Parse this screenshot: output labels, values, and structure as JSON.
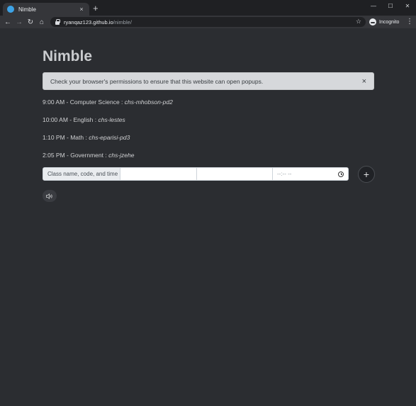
{
  "browser": {
    "tab_title": "Nimble",
    "tab_close": "×",
    "new_tab": "+",
    "window_controls": {
      "minimize": "—",
      "maximize": "☐",
      "close": "✕"
    },
    "nav": {
      "back": "←",
      "forward": "→",
      "reload": "↻",
      "home": "⌂"
    },
    "url_host": "ryanqaz123.github.io",
    "url_path": "/nimble/",
    "star": "☆",
    "incognito_label": "Incognito",
    "menu": "⋮"
  },
  "page": {
    "title": "Nimble",
    "alert": {
      "text": "Check your browser's permissions to ensure that this website can open popups.",
      "close": "×"
    },
    "classes": [
      {
        "time": "9:00 AM",
        "name": "Computer Science",
        "code": "chs-mhobson-pd2"
      },
      {
        "time": "10:00 AM",
        "name": "English",
        "code": "chs-lestes"
      },
      {
        "time": "1:10 PM",
        "name": "Math",
        "code": "chs-eparisi-pd3"
      },
      {
        "time": "2:05 PM",
        "name": "Government",
        "code": "chs-jzehe"
      }
    ],
    "form": {
      "label": "Class name, code, and time",
      "name_value": "",
      "code_value": "",
      "time_placeholder": "--:-- --",
      "add_label": "+"
    }
  },
  "colors": {
    "page_bg": "#2b2d31",
    "alert_bg": "#d6d8db",
    "chrome_bg": "#35363a"
  },
  "icons": [
    "favicon-icon",
    "lock-icon",
    "star-icon",
    "incognito-icon",
    "clock-icon",
    "speaker-icon",
    "plus-icon"
  ]
}
